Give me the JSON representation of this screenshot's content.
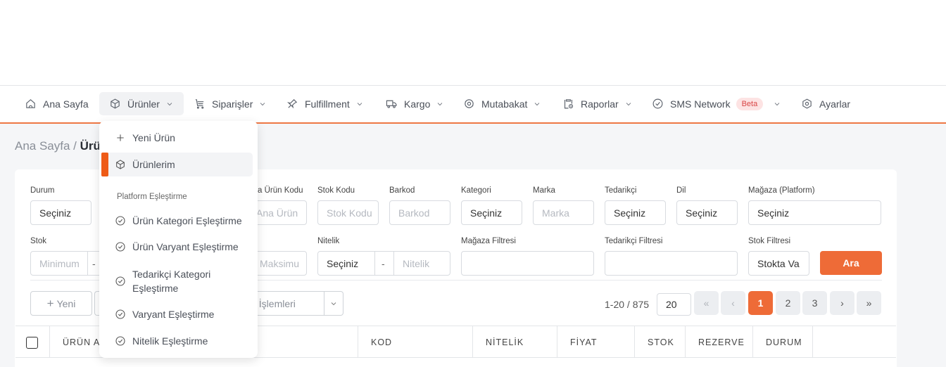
{
  "nav": {
    "home": "Ana Sayfa",
    "products": "Ürünler",
    "orders": "Siparişler",
    "fulfillment": "Fulfillment",
    "cargo": "Kargo",
    "reconciliation": "Mutabakat",
    "reports": "Raporlar",
    "sms": "SMS Network",
    "sms_badge": "Beta",
    "settings": "Ayarlar"
  },
  "breadcrumb": {
    "home": "Ana Sayfa /",
    "current": "Ürü"
  },
  "dropdown": {
    "new_product": "Yeni Ürün",
    "my_products": "Ürünlerim",
    "section": "Platform Eşleştirme",
    "items": [
      "Ürün Kategori Eşleştirme",
      "Ürün Varyant Eşleştirme",
      "Tedarikçi Kategori Eşleştirme",
      "Varyant Eşleştirme",
      "Nitelik Eşleştirme"
    ]
  },
  "filters": {
    "durum": {
      "label": "Durum",
      "value": "Seçiniz"
    },
    "ana_urun_kodu": {
      "label": "a Ürün Kodu",
      "placeholder": "Ana Ürün"
    },
    "stok_kodu": {
      "label": "Stok Kodu",
      "placeholder": "Stok Kodu"
    },
    "barkod": {
      "label": "Barkod",
      "placeholder": "Barkod"
    },
    "kategori": {
      "label": "Kategori",
      "value": "Seçiniz"
    },
    "marka": {
      "label": "Marka",
      "placeholder": "Marka"
    },
    "tedarikci": {
      "label": "Tedarikçi",
      "value": "Seçiniz"
    },
    "dil": {
      "label": "Dil",
      "value": "Seçiniz"
    },
    "magaza": {
      "label": "Mağaza (Platform)",
      "value": "Seçiniz"
    },
    "stok": {
      "label": "Stok",
      "min_placeholder": "Minimum",
      "dash": "-"
    },
    "max_placeholder": "Maksimu",
    "nitelik": {
      "label": "Nitelik",
      "value": "Seçiniz",
      "dash": "-",
      "placeholder": "Nitelik"
    },
    "magaza_filtresi": {
      "label": "Mağaza Filtresi"
    },
    "tedarikci_filtresi": {
      "label": "Tedarikçi Filtresi"
    },
    "stok_filtresi": {
      "label": "Stok Filtresi",
      "value": "Stokta Va"
    },
    "search_button": "Ara"
  },
  "toolbar": {
    "new_button": "Yeni",
    "bulk_label": "cel İşlemleri"
  },
  "pagination": {
    "range": "1-20 / 875",
    "page_size": "20",
    "first": "«",
    "prev": "‹",
    "pages": [
      "1",
      "2",
      "3"
    ],
    "current": "1",
    "next": "›",
    "last": "»"
  },
  "table": {
    "columns": [
      "ÜRÜN AI",
      "KOD",
      "NİTELİK",
      "FİYAT",
      "STOK",
      "REZERVE",
      "DURUM"
    ]
  }
}
